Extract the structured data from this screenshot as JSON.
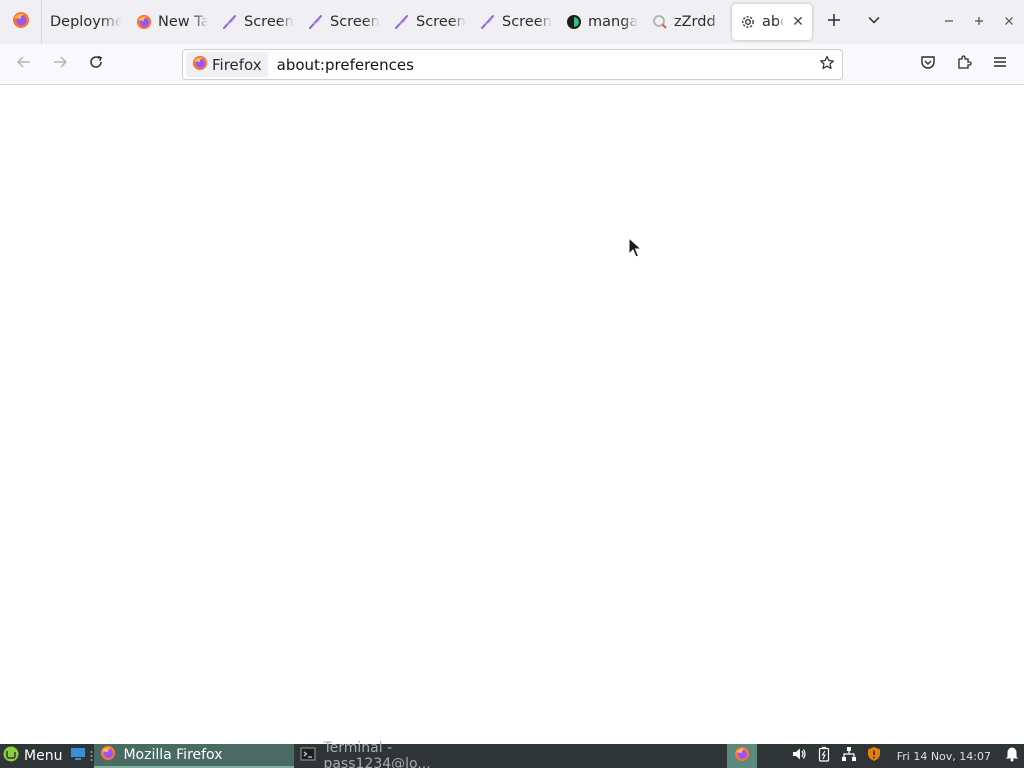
{
  "browser": {
    "tabs": [
      {
        "label": "Deployme",
        "icon": "generic-page-icon",
        "active": false
      },
      {
        "label": "New Tab",
        "icon": "firefox-icon",
        "active": false
      },
      {
        "label": "Screen",
        "icon": "feather-icon",
        "active": false
      },
      {
        "label": "Screen",
        "icon": "feather-icon",
        "active": false
      },
      {
        "label": "Screen",
        "icon": "feather-icon",
        "active": false
      },
      {
        "label": "Screen",
        "icon": "feather-icon",
        "active": false
      },
      {
        "label": "manga",
        "icon": "manga-site-icon",
        "active": false
      },
      {
        "label": "zZrdd",
        "icon": "search-engine-icon",
        "active": false
      },
      {
        "label": "about",
        "icon": "gear-icon",
        "active": true
      }
    ],
    "identity_label": "Firefox",
    "url": "about:preferences"
  },
  "taskbar": {
    "menu_label": "Menu",
    "windows": [
      {
        "label": "Mozilla Firefox",
        "icon": "firefox-icon",
        "active": true
      },
      {
        "label": "Terminal - pass1234@lo...",
        "icon": "terminal-icon",
        "active": false
      }
    ],
    "clock": "Fri 14 Nov, 14:07"
  },
  "colors": {
    "tabstrip_bg": "#f0f0f4",
    "navbar_bg": "#f9f9fb",
    "taskbar_bg": "#2f3437",
    "taskbar_active": "#4a6b63",
    "feather_purple": "#8a5cd6",
    "tray_ff_bg": "#5a8a7c"
  }
}
